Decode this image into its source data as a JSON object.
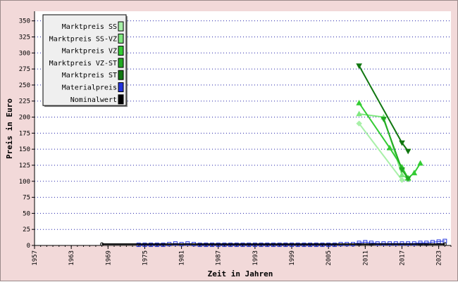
{
  "chart_data": {
    "type": "line",
    "title": "",
    "xlabel": "Zeit in Jahren",
    "ylabel": "Preis in Euro",
    "xlim": [
      1957,
      2025
    ],
    "ylim": [
      0,
      365
    ],
    "x_ticks": [
      "1957",
      "1963",
      "1969",
      "1975",
      "1981",
      "1987",
      "1993",
      "1999",
      "2005",
      "2011",
      "2017",
      "2023"
    ],
    "y_ticks": [
      "0",
      "25",
      "50",
      "75",
      "100",
      "125",
      "150",
      "175",
      "200",
      "225",
      "250",
      "275",
      "300",
      "325",
      "350"
    ],
    "grid": "horizontal dotted",
    "legend_position": "top-left",
    "series": [
      {
        "name": "Marktpreis SS",
        "color": "#a8f0a8",
        "marker": "diamond",
        "points": [
          [
            2010,
            190
          ],
          [
            2017,
            102
          ],
          [
            2018,
            103
          ]
        ]
      },
      {
        "name": "Marktpreis SS-VZ",
        "color": "#7ee87e",
        "marker": "triangle-up",
        "points": [
          [
            2010,
            205
          ],
          [
            2014,
            200
          ],
          [
            2017,
            110
          ],
          [
            2018,
            104
          ]
        ]
      },
      {
        "name": "Marktpreis VZ",
        "color": "#33cc33",
        "marker": "triangle-up",
        "points": [
          [
            2010,
            222
          ],
          [
            2015,
            152
          ],
          [
            2017,
            122
          ],
          [
            2018,
            105
          ],
          [
            2019,
            113
          ],
          [
            2020,
            128
          ]
        ]
      },
      {
        "name": "Marktpreis VZ-ST",
        "color": "#22aa22",
        "marker": "triangle-down",
        "points": [
          [
            2014,
            197
          ],
          [
            2017,
            118
          ],
          [
            2018,
            104
          ]
        ]
      },
      {
        "name": "Marktpreis ST",
        "color": "#117711",
        "marker": "triangle-down",
        "points": [
          [
            2010,
            280
          ],
          [
            2017,
            160
          ],
          [
            2018,
            147
          ]
        ]
      },
      {
        "name": "Materialpreis",
        "color": "#2233dd",
        "marker": "square",
        "points": [
          [
            1974,
            1
          ],
          [
            1975,
            1
          ],
          [
            1976,
            1
          ],
          [
            1977,
            1
          ],
          [
            1978,
            1
          ],
          [
            1979,
            2
          ],
          [
            1980,
            3
          ],
          [
            1981,
            2
          ],
          [
            1982,
            3
          ],
          [
            1983,
            2
          ],
          [
            1984,
            1
          ],
          [
            1985,
            1
          ],
          [
            1986,
            1
          ],
          [
            1987,
            1
          ],
          [
            1988,
            1
          ],
          [
            1989,
            1
          ],
          [
            1990,
            1
          ],
          [
            1991,
            1
          ],
          [
            1992,
            1
          ],
          [
            1993,
            1
          ],
          [
            1994,
            1
          ],
          [
            1995,
            1
          ],
          [
            1996,
            1
          ],
          [
            1997,
            1
          ],
          [
            1998,
            1
          ],
          [
            1999,
            1
          ],
          [
            2000,
            1
          ],
          [
            2001,
            1
          ],
          [
            2002,
            1
          ],
          [
            2003,
            1
          ],
          [
            2004,
            1
          ],
          [
            2005,
            1
          ],
          [
            2006,
            1
          ],
          [
            2007,
            2
          ],
          [
            2008,
            2
          ],
          [
            2009,
            2
          ],
          [
            2010,
            4
          ],
          [
            2011,
            5
          ],
          [
            2012,
            4
          ],
          [
            2013,
            3
          ],
          [
            2014,
            3
          ],
          [
            2015,
            3
          ],
          [
            2016,
            3
          ],
          [
            2017,
            3
          ],
          [
            2018,
            3
          ],
          [
            2019,
            3
          ],
          [
            2020,
            4
          ],
          [
            2021,
            4
          ],
          [
            2022,
            5
          ],
          [
            2023,
            6
          ],
          [
            2024,
            7
          ]
        ]
      },
      {
        "name": "Nominalwert",
        "color": "#000000",
        "marker": "circle",
        "points": [
          [
            1968,
            2
          ],
          [
            2024,
            2
          ]
        ]
      }
    ]
  }
}
